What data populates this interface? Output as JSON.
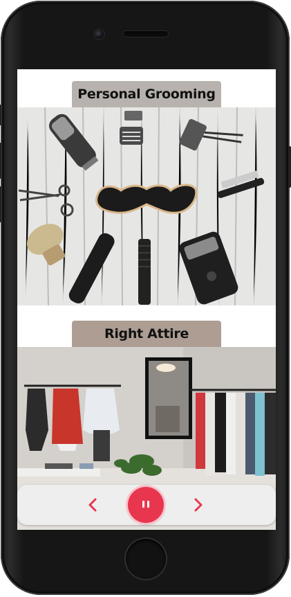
{
  "device": "smartphone",
  "slides": [
    {
      "title": "Personal Grooming",
      "image": "grooming-tools-photo"
    },
    {
      "title": "Right Attire",
      "image": "clothing-store-photo"
    }
  ],
  "controls": {
    "prev_icon": "chevron-left-icon",
    "play_pause_icon": "pause-icon",
    "next_icon": "chevron-right-icon"
  },
  "colors": {
    "accent": "#e8364f",
    "title1_bg": "#b7b2ad",
    "title2_bg": "#ad9d92",
    "control_bar": "#eeeeee"
  }
}
